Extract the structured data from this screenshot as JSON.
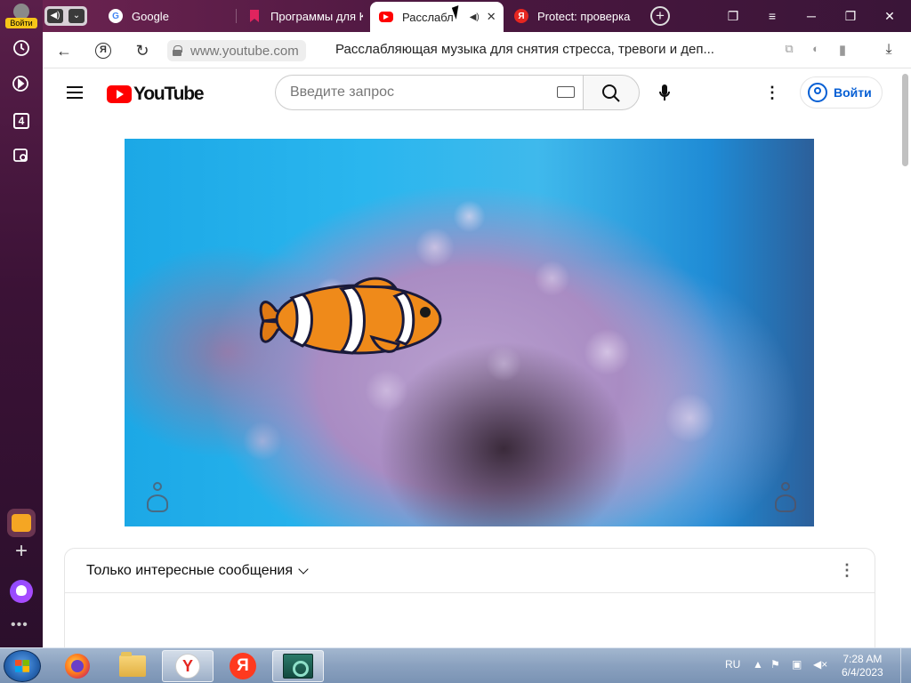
{
  "browser": {
    "profile_login": "Войти",
    "tabs": [
      {
        "title": "Google",
        "favicon": "google-icon"
      },
      {
        "title": "Программы для K",
        "favicon": "bookmark-icon"
      },
      {
        "title": "Расслабл",
        "favicon": "youtube-icon",
        "active": true
      },
      {
        "title": "Protect: проверка",
        "favicon": "yandex-icon"
      }
    ],
    "url_host": "www.youtube.com",
    "page_title": "Расслабляющая музыка для снятия стресса, тревоги и деп...",
    "sidebar_badge": "4",
    "accent_color": "#5a1f4a"
  },
  "youtube": {
    "logo_text": "YouTube",
    "search_placeholder": "Введите запрос",
    "signin_label": "Войти",
    "brand_color": "#ff0000",
    "link_color": "#065fd4"
  },
  "chat": {
    "filter_label": "Только интересные сообщения"
  },
  "taskbar": {
    "language": "RU",
    "time": "7:28 AM",
    "date": "6/4/2023"
  }
}
